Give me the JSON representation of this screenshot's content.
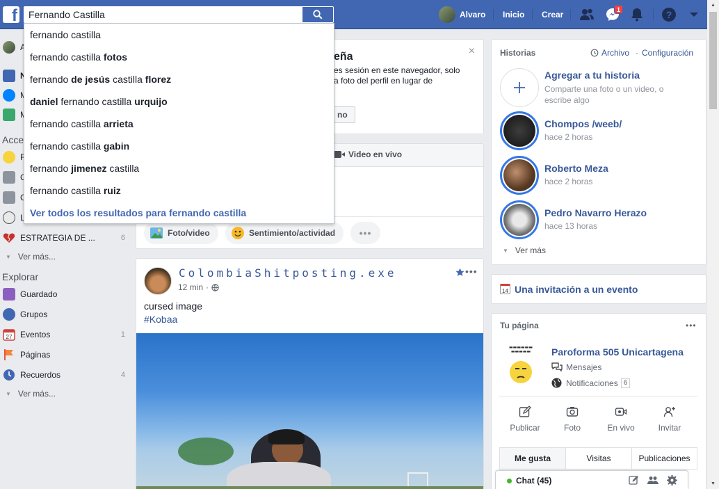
{
  "topbar": {
    "search_value": "Fernando Castilla",
    "user_name": "Alvaro",
    "home_label": "Inicio",
    "create_label": "Crear",
    "messenger_badge": "1"
  },
  "search_dropdown": {
    "suggestions": [
      {
        "pre": "fernando castilla",
        "bold": "",
        "post": ""
      },
      {
        "pre": "fernando castilla ",
        "bold": "fotos",
        "post": ""
      },
      {
        "pre": "fernando ",
        "bold": "de jesús",
        "post": " castilla ",
        "bold2": "florez"
      },
      {
        "pre": "",
        "bold": "daniel",
        "post": " fernando castilla ",
        "bold2": "urquijo"
      },
      {
        "pre": "fernando castilla ",
        "bold": "arrieta",
        "post": ""
      },
      {
        "pre": "fernando castilla ",
        "bold": "gabin",
        "post": ""
      },
      {
        "pre": "fernando ",
        "bold": "jimenez",
        "post": " castilla"
      },
      {
        "pre": "fernando castilla ",
        "bold": "ruiz",
        "post": ""
      }
    ],
    "see_all": "Ver todos los resultados para fernando castilla"
  },
  "left_sidebar": {
    "top_items": [
      "A",
      "N",
      "M",
      "M"
    ],
    "shortcuts_head": "Acce",
    "shortcuts": [
      {
        "label": "F",
        "count": ""
      },
      {
        "label": "C",
        "count": ""
      },
      {
        "label": "C",
        "count": ""
      },
      {
        "label": "L",
        "count": ""
      },
      {
        "label": "ESTRATEGIA DE ...",
        "count": "6"
      }
    ],
    "more1": "Ver más...",
    "explore_head": "Explorar",
    "explore": [
      {
        "label": "Guardado",
        "count": ""
      },
      {
        "label": "Grupos",
        "count": ""
      },
      {
        "label": "Eventos",
        "count": "1"
      },
      {
        "label": "Páginas",
        "count": ""
      },
      {
        "label": "Recuerdos",
        "count": "4"
      }
    ],
    "more2": "Ver más..."
  },
  "center": {
    "notice_title": "eña",
    "notice_line1": "es sesión en este navegador, solo",
    "notice_line2": "a foto del perfil en lugar de",
    "notice_button": "no",
    "composer_live": "Video en vivo",
    "chip_photo": "Foto/video",
    "chip_feeling": "Sentimiento/actividad",
    "post_author": "ColombiaShitposting.exe",
    "post_time": "12 min",
    "post_text": "cursed image",
    "post_tag": "#Kobaa"
  },
  "right_sidebar": {
    "stories_title": "Historias",
    "archive": "Archivo",
    "settings": "Configuración",
    "add_story_title": "Agregar a tu historia",
    "add_story_desc1": "Comparte una foto o un video, o",
    "add_story_desc2": "escribe algo",
    "stories": [
      {
        "name": "Chompos /weeb/",
        "time": "hace 2 horas"
      },
      {
        "name": "Roberto Meza",
        "time": "hace 2 horas"
      },
      {
        "name": "Pedro Navarro Herazo",
        "time": "hace 13 horas"
      }
    ],
    "see_more": "Ver más",
    "event_invite": "Una invitación a un evento",
    "calendar_day": "14",
    "your_page": "Tu página",
    "page_name": "Paroforma 505 Unicartagena",
    "messages": "Mensajes",
    "notifications": "Notificaciones",
    "notif_count": "6",
    "actions": [
      "Publicar",
      "Foto",
      "En vivo",
      "Invitar"
    ],
    "tabs": [
      "Me gusta",
      "Visitas",
      "Publicaciones"
    ],
    "chat": "Chat (45)"
  },
  "colors": {
    "fb_blue": "#4267b2",
    "link_blue": "#385898",
    "accent": "#3578e5"
  }
}
